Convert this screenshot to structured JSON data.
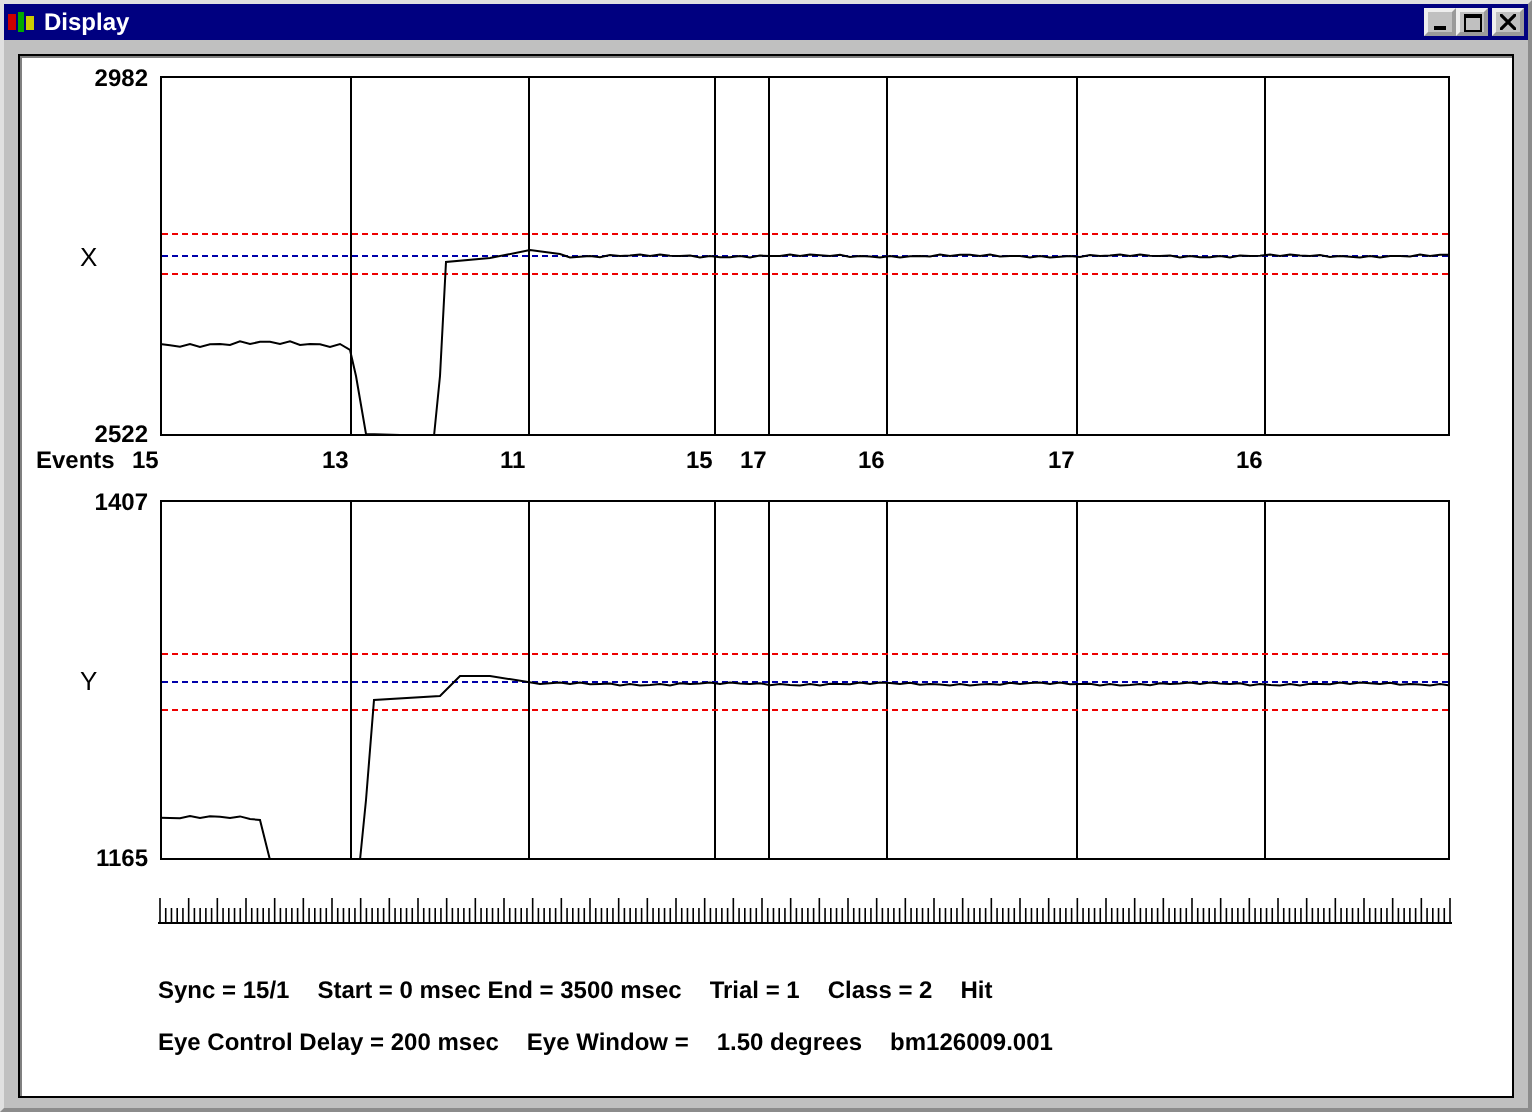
{
  "window": {
    "title": "Display"
  },
  "plots": [
    {
      "name": "X",
      "max": "2982",
      "min": "2522"
    },
    {
      "name": "Y",
      "max": "1407",
      "min": "1165"
    }
  ],
  "events": {
    "label": "Events",
    "values": [
      "15",
      "13",
      "11",
      "15",
      "17",
      "16",
      "17",
      "16"
    ]
  },
  "status": [
    [
      "Sync = 15/1",
      "Start = 0 msec End = 3500 msec",
      "Trial = 1",
      "Class = 2",
      "Hit"
    ],
    [
      "Eye Control Delay = 200 msec",
      "Eye Window =",
      "1.50 degrees",
      "bm126009.001"
    ]
  ]
}
